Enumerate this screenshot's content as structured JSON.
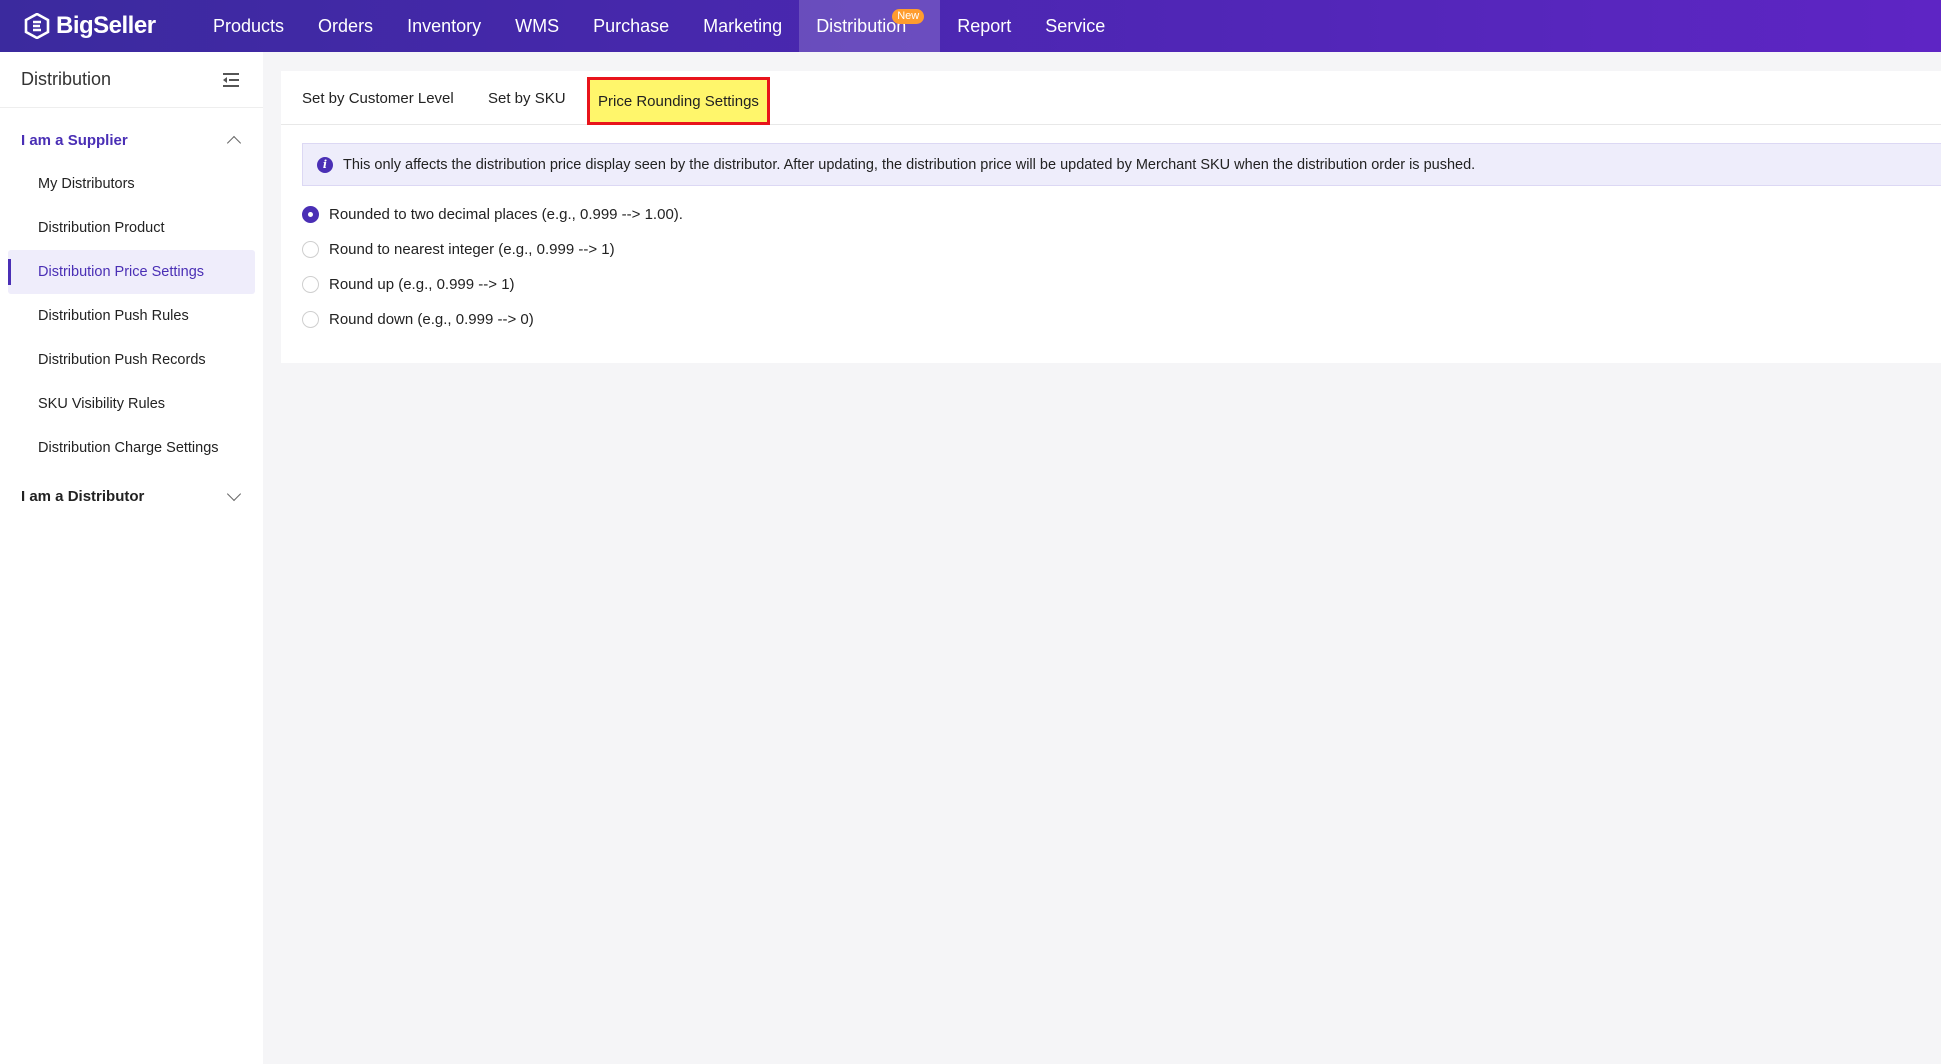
{
  "brand": {
    "name": "BigSeller"
  },
  "nav": {
    "items": [
      {
        "label": "Products"
      },
      {
        "label": "Orders"
      },
      {
        "label": "Inventory"
      },
      {
        "label": "WMS"
      },
      {
        "label": "Purchase"
      },
      {
        "label": "Marketing"
      },
      {
        "label": "Distribution",
        "badge": "New",
        "active": true
      },
      {
        "label": "Report"
      },
      {
        "label": "Service"
      }
    ]
  },
  "sidebar": {
    "title": "Distribution",
    "supplier_group": "I am a Supplier",
    "items": [
      {
        "label": "My Distributors"
      },
      {
        "label": "Distribution Product"
      },
      {
        "label": "Distribution Price Settings",
        "active": true
      },
      {
        "label": "Distribution Push Rules"
      },
      {
        "label": "Distribution Push Records"
      },
      {
        "label": "SKU Visibility Rules"
      },
      {
        "label": "Distribution Charge Settings"
      }
    ],
    "distributor_group": "I am a Distributor"
  },
  "tabs": [
    {
      "label": "Set by Customer Level"
    },
    {
      "label": "Set by SKU"
    },
    {
      "label": "Price Rounding Settings",
      "active": true
    }
  ],
  "notice": {
    "icon": "info-icon",
    "text": "This only affects the distribution price display seen by the distributor. After updating, the distribution price will be updated by Merchant SKU when the distribution order is pushed."
  },
  "rounding_options": [
    {
      "label": "Rounded to two decimal places (e.g., 0.999 --> 1.00).",
      "checked": true
    },
    {
      "label": "Round to nearest integer (e.g., 0.999 --> 1)",
      "checked": false
    },
    {
      "label": "Round up (e.g., 0.999 --> 1)",
      "checked": false
    },
    {
      "label": "Round down (e.g., 0.999 --> 0)",
      "checked": false
    }
  ],
  "colors": {
    "accent": "#4a2fb5",
    "highlight": "#fff66b",
    "highlight_border": "#e8141b",
    "badge": "#ff9c2e"
  }
}
